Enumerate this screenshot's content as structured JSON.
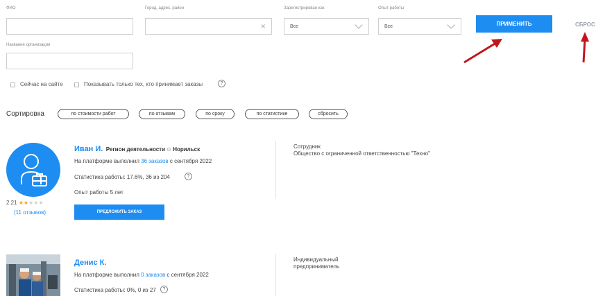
{
  "filters": {
    "fio_label": "ФИО",
    "city_label": "Город, адрес, район",
    "registered_label": "Зарегистрирован как",
    "registered_value": "Все",
    "experience_label": "Опыт работы",
    "experience_value": "Все",
    "apply_label": "ПРИМЕНИТЬ",
    "reset_label": "СБРОС",
    "org_label": "Название организации",
    "online_label": "Сейчас на сайте",
    "orders_only_label": "Показывать только тех, кто принимает заказы",
    "help": "?"
  },
  "sort": {
    "title": "Сортировка",
    "options": [
      "по стоимости работ",
      "по отзывам",
      "по сроку",
      "по статистике",
      "сбросить"
    ]
  },
  "workers": [
    {
      "name": "Иван И.",
      "region_label": "Регион деятельности",
      "region": "Норильск",
      "orders_prefix": "На платформе выполнил ",
      "orders_link": "36 заказов",
      "orders_suffix": " с сентября 2022",
      "stats": "Статистика работы: 17.6%, 36 из 204",
      "experience": "Опыт работы 5 лет",
      "rating": "2.21",
      "rating_value": 2,
      "reviews": "(11 отзывов)",
      "offer_label": "ПРЕДЛОЖИТЬ ЗАКАЗ",
      "role": "Сотрудник",
      "org": "Общество с ограниченной ответственностью \"Техно\""
    },
    {
      "name": "Денис К.",
      "orders_prefix": "На платформе выполнил ",
      "orders_link": "0 заказов",
      "orders_suffix": " с сентября 2022",
      "stats": "Статистика работы: 0%, 0 из 27",
      "role": "Индивидуальный предприниматель"
    }
  ],
  "colors": {
    "accent": "#1e8df2",
    "arrow": "#c0161c",
    "star": "#f5a623"
  }
}
